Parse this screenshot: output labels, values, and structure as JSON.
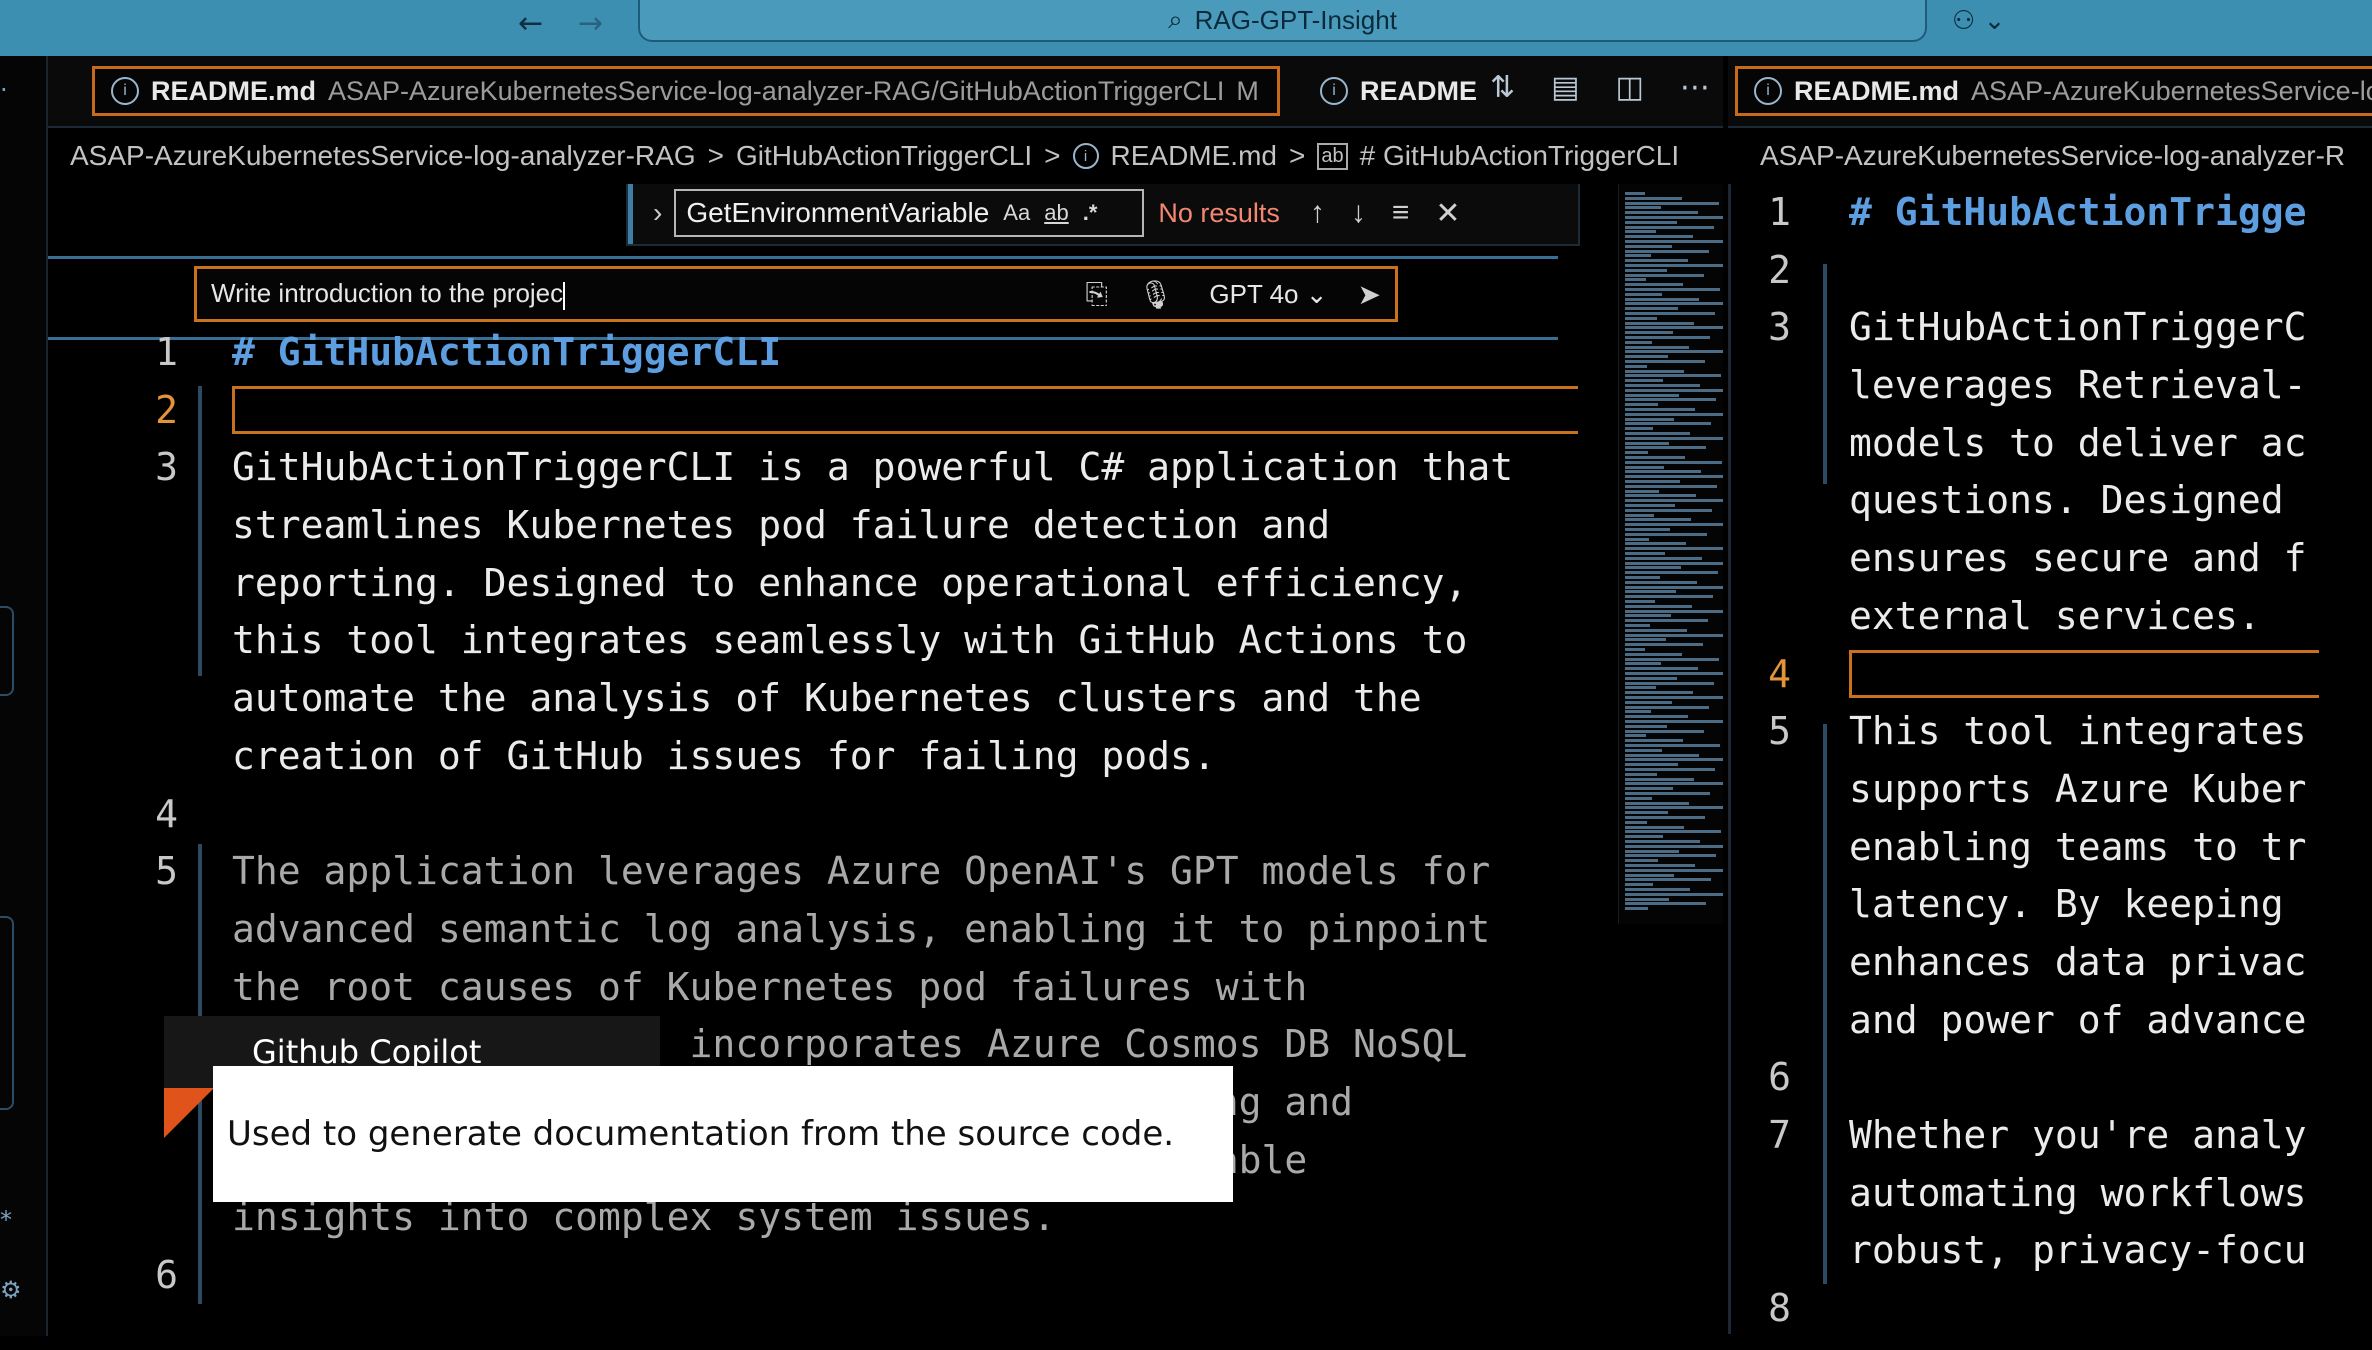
{
  "titlebar": {
    "back_icon": "arrow-left",
    "forward_icon": "arrow-right",
    "search_text": "RAG-GPT-Insight",
    "copilot_icon": "copilot"
  },
  "tabs_left": [
    {
      "name": "README.md",
      "path": "ASAP-AzureKubernetesService-log-analyzer-RAG/GitHubActionTriggerCLI",
      "status": "M",
      "close": "×"
    },
    {
      "name": "README"
    }
  ],
  "tabs_right": [
    {
      "name": "README.md",
      "path": "ASAP-AzureKubernetesService-lo"
    }
  ],
  "breadcrumb_left": [
    "ASAP-AzureKubernetesService-log-analyzer-RAG",
    "GitHubActionTriggerCLI",
    "README.md",
    "# GitHubActionTriggerCLI"
  ],
  "breadcrumb_right": [
    "ASAP-AzureKubernetesService-log-analyzer-R"
  ],
  "find": {
    "query": "GetEnvironmentVariable",
    "opt_case": "Aa",
    "opt_word": "ab",
    "opt_regex": ".*",
    "status": "No results"
  },
  "chat": {
    "input": "Write introduction to the projec",
    "model": "GPT 4o"
  },
  "editor_left": {
    "lines": [
      {
        "n": "1",
        "t": "# GitHubActionTriggerCLI"
      },
      {
        "n": "2",
        "t": ""
      },
      {
        "n": "3",
        "t": "GitHubActionTriggerCLI is a powerful C# application that"
      },
      {
        "n": "",
        "t": "streamlines Kubernetes pod failure detection and"
      },
      {
        "n": "",
        "t": "reporting. Designed to enhance operational efficiency,"
      },
      {
        "n": "",
        "t": "this tool integrates seamlessly with GitHub Actions to"
      },
      {
        "n": "",
        "t": "automate the analysis of Kubernetes clusters and the"
      },
      {
        "n": "",
        "t": "creation of GitHub issues for failing pods."
      },
      {
        "n": "4",
        "t": ""
      },
      {
        "n": "5",
        "t": "The application leverages Azure OpenAI's GPT models for"
      },
      {
        "n": "",
        "t": "advanced semantic log analysis, enabling it to pinpoint"
      },
      {
        "n": "",
        "t": "the root causes of Kubernetes pod failures with"
      },
      {
        "n": "",
        "t": "                    incorporates Azure Cosmos DB NoSQL"
      },
      {
        "n": "",
        "t": "                                        exing and"
      },
      {
        "n": "",
        "t": "                                        eliable"
      },
      {
        "n": "",
        "t": "insights into complex system issues."
      },
      {
        "n": "6",
        "t": ""
      }
    ]
  },
  "editor_right": {
    "lines": [
      {
        "n": "1",
        "t": "# GitHubActionTrigge"
      },
      {
        "n": "2",
        "t": ""
      },
      {
        "n": "3",
        "t": "GitHubActionTriggerC"
      },
      {
        "n": "",
        "t": "leverages Retrieval-"
      },
      {
        "n": "",
        "t": "models to deliver ac"
      },
      {
        "n": "",
        "t": "questions. Designed "
      },
      {
        "n": "",
        "t": "ensures secure and f"
      },
      {
        "n": "",
        "t": "external services."
      },
      {
        "n": "4",
        "t": ""
      },
      {
        "n": "5",
        "t": "This tool integrates"
      },
      {
        "n": "",
        "t": "supports Azure Kuber"
      },
      {
        "n": "",
        "t": "enabling teams to tr"
      },
      {
        "n": "",
        "t": "latency. By keeping "
      },
      {
        "n": "",
        "t": "enhances data privac"
      },
      {
        "n": "",
        "t": "and power of advance"
      },
      {
        "n": "6",
        "t": ""
      },
      {
        "n": "7",
        "t": "Whether you're analy"
      },
      {
        "n": "",
        "t": "automating workflows"
      },
      {
        "n": "",
        "t": "robust, privacy-focu"
      },
      {
        "n": "8",
        "t": ""
      }
    ]
  },
  "tooltip": {
    "title": "Github Copilot",
    "body": "Used to generate documentation from the source code."
  },
  "colors": {
    "titlebar": "#3c8fb0",
    "accent_orange": "#c8721e",
    "heading_blue": "#5c9ee0",
    "no_results": "#f48771"
  }
}
